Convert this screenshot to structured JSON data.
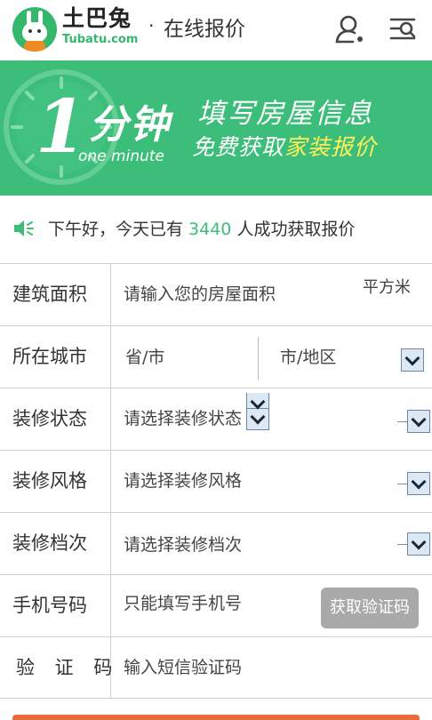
{
  "header": {
    "logo_cn": "土巴兔",
    "logo_en": "Tubatu.com",
    "separator": "·",
    "title": "在线报价",
    "user_icon": "user-icon",
    "menu_icon": "menu-search-icon"
  },
  "banner": {
    "big_number": "1",
    "minute_cn": "分钟",
    "minute_en": "one minute",
    "line1": "填写房屋信息",
    "line2_prefix": "免费获取",
    "line2_highlight": "家装报价",
    "colors": {
      "background": "#3dbd7a",
      "highlight": "#ffef5a"
    }
  },
  "notice": {
    "icon": "speaker-icon",
    "prefix": "下午好，今天已有 ",
    "count": "3440",
    "suffix": " 人成功获取报价"
  },
  "form": {
    "area": {
      "label": "建筑面积",
      "placeholder": "请输入您的房屋面积",
      "unit": "平方米"
    },
    "city": {
      "label": "所在城市",
      "province": "省/市",
      "district": "市/地区"
    },
    "status": {
      "label": "装修状态",
      "value": "请选择装修状态"
    },
    "style": {
      "label": "装修风格",
      "value": "请选择装修风格"
    },
    "grade": {
      "label": "装修档次",
      "value": "请选择装修档次"
    },
    "phone": {
      "label": "手机号码",
      "placeholder": "只能填写手机号",
      "button": "获取验证码"
    },
    "code": {
      "label": "验 证 码",
      "placeholder": "输入短信验证码"
    }
  },
  "colors": {
    "accent": "#3dbd7a",
    "button_disabled": "#a9a9a9",
    "bottom_bar": "#e96b3a"
  }
}
